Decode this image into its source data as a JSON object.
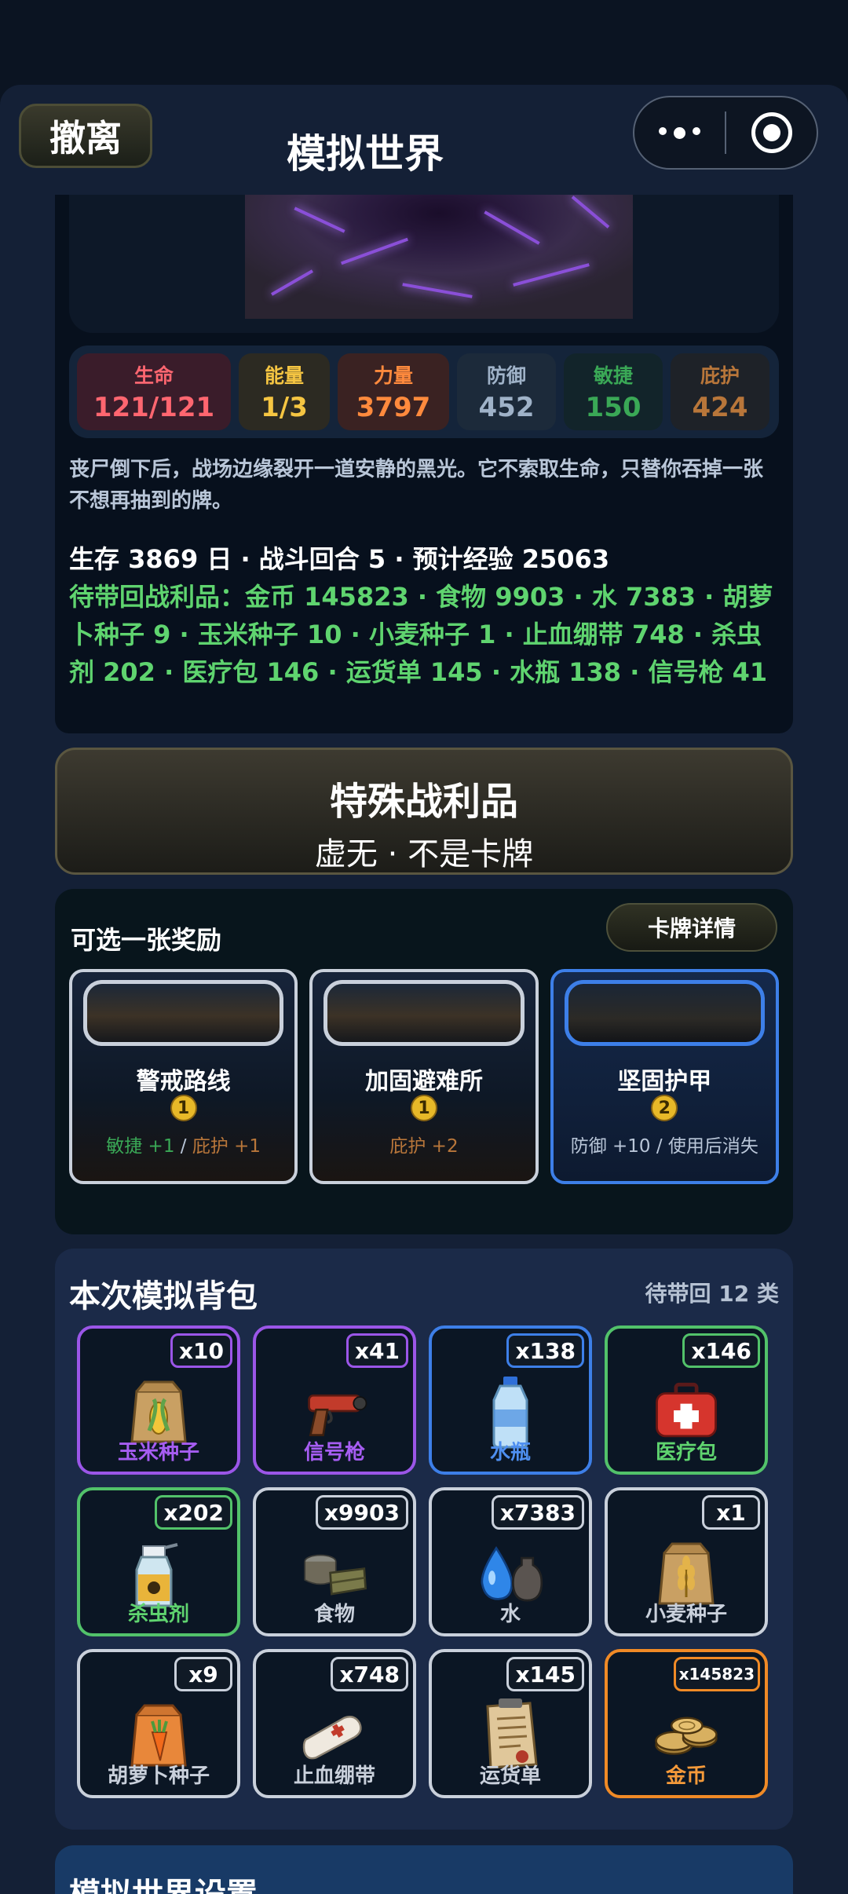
{
  "header": {
    "exit_label": "撤离",
    "title": "模拟世界"
  },
  "stats": [
    {
      "label": "生命",
      "value": "121/121",
      "color": "#ff6670",
      "bg": "#3a1c2a"
    },
    {
      "label": "能量",
      "value": "1/3",
      "color": "#f5c542",
      "bg": "#2c2a22"
    },
    {
      "label": "力量",
      "value": "3797",
      "color": "#ff8a3d",
      "bg": "#3a2222"
    },
    {
      "label": "防御",
      "value": "452",
      "color": "#9fb2c8",
      "bg": "#1c2a3a"
    },
    {
      "label": "敏捷",
      "value": "150",
      "color": "#3aa856",
      "bg": "#12242a"
    },
    {
      "label": "庇护",
      "value": "424",
      "color": "#b8763a",
      "bg": "#1e2228"
    }
  ],
  "narrative": "丧尸倒下后，战场边缘裂开一道安静的黑光。它不索取生命，只替你吞掉一张不想再抽到的牌。",
  "summary": {
    "line1": "生存 3869 日 · 战斗回合 5 · 预计经验 25063",
    "loot": "待带回战利品：金币 145823 · 食物 9903 · 水 7383 · 胡萝卜种子 9 · 玉米种子 10 · 小麦种子 1 · 止血绷带 748 · 杀虫剂 202 · 医疗包 146 · 运货单 145 · 水瓶 138 · 信号枪 41"
  },
  "special_loot": {
    "title": "特殊战利品",
    "subtitle": "虚无 · 不是卡牌"
  },
  "rewards": {
    "heading": "可选一张奖励",
    "detail_label": "卡牌详情",
    "cards": [
      {
        "name": "警戒路线",
        "cost": "1",
        "effect_a": "敏捷 +1",
        "sep": " / ",
        "effect_b": "庇护 +1",
        "color_a": "#3aa856",
        "color_b": "#b8763a"
      },
      {
        "name": "加固避难所",
        "cost": "1",
        "effect_a": "",
        "sep": "",
        "effect_b": "庇护 +2",
        "color_a": "#b8763a",
        "color_b": "#b8763a"
      },
      {
        "name": "坚固护甲",
        "cost": "2",
        "effect_a": "防御 +10 / 使用后消失",
        "sep": "",
        "effect_b": "",
        "color_a": "#b9c6d8",
        "color_b": "#b9c6d8"
      }
    ]
  },
  "backpack": {
    "heading": "本次模拟背包",
    "count_label": "待带回 12 类",
    "items": [
      {
        "name": "玉米种子",
        "qty": "x10",
        "rarity": "purple",
        "icon": "seed-bag-corn-icon"
      },
      {
        "name": "信号枪",
        "qty": "x41",
        "rarity": "purple",
        "icon": "flare-gun-icon"
      },
      {
        "name": "水瓶",
        "qty": "x138",
        "rarity": "blue",
        "icon": "water-bottle-icon"
      },
      {
        "name": "医疗包",
        "qty": "x146",
        "rarity": "green",
        "icon": "medkit-icon"
      },
      {
        "name": "杀虫剂",
        "qty": "x202",
        "rarity": "green",
        "icon": "spray-bottle-icon"
      },
      {
        "name": "食物",
        "qty": "x9903",
        "rarity": "white",
        "icon": "food-can-icon"
      },
      {
        "name": "水",
        "qty": "x7383",
        "rarity": "white",
        "icon": "water-drop-icon"
      },
      {
        "name": "小麦种子",
        "qty": "x1",
        "rarity": "white",
        "icon": "seed-bag-wheat-icon"
      },
      {
        "name": "胡萝卜种子",
        "qty": "x9",
        "rarity": "white",
        "icon": "seed-bag-carrot-icon"
      },
      {
        "name": "止血绷带",
        "qty": "x748",
        "rarity": "white",
        "icon": "bandage-icon"
      },
      {
        "name": "运货单",
        "qty": "x145",
        "rarity": "white",
        "icon": "scroll-icon"
      },
      {
        "name": "金币",
        "qty": "x145823",
        "rarity": "orange",
        "icon": "gold-coins-icon"
      }
    ]
  },
  "next_section_title": "模拟世界设置"
}
